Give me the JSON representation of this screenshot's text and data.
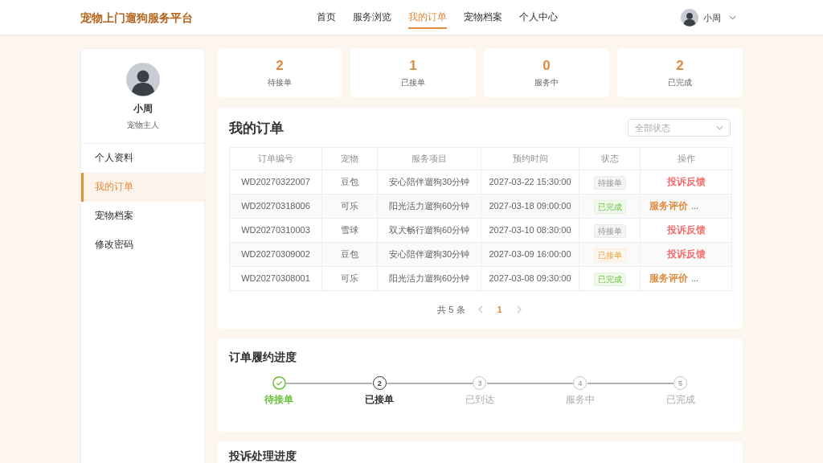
{
  "header": {
    "logo": "宠物上门遛狗服务平台",
    "nav": [
      {
        "label": "首页",
        "selected": false
      },
      {
        "label": "服务浏览",
        "selected": false
      },
      {
        "label": "我的订单",
        "selected": true
      },
      {
        "label": "宠物档案",
        "selected": false
      },
      {
        "label": "个人中心",
        "selected": false
      }
    ],
    "user": {
      "name": "小周"
    }
  },
  "sidebar": {
    "profile": {
      "name": "小周",
      "role": "宠物主人"
    },
    "items": [
      {
        "label": "个人资料",
        "selected": false
      },
      {
        "label": "我的订单",
        "selected": true
      },
      {
        "label": "宠物档案",
        "selected": false
      },
      {
        "label": "修改密码",
        "selected": false
      }
    ]
  },
  "stats": [
    {
      "value": "2",
      "label": "待接单"
    },
    {
      "value": "1",
      "label": "已接单"
    },
    {
      "value": "0",
      "label": "服务中"
    },
    {
      "value": "2",
      "label": "已完成"
    }
  ],
  "orders": {
    "title": "我的订单",
    "filter": {
      "placeholder": "全部状态"
    },
    "table": {
      "columns": [
        "订单编号",
        "宠物",
        "服务项目",
        "预约时间",
        "状态",
        "操作"
      ],
      "rows": [
        {
          "cells": [
            "WD20270322007",
            "豆包",
            "安心陪伴遛狗30分钟",
            "2027-03-22 15:30:00"
          ],
          "status": {
            "label": "待接单",
            "kind": "pending"
          },
          "actions": [
            {
              "label": "投诉反馈",
              "kind": "complaint"
            }
          ]
        },
        {
          "cells": [
            "WD20270318006",
            "可乐",
            "阳光活力遛狗60分钟",
            "2027-03-18 09:00:00"
          ],
          "status": {
            "label": "已完成",
            "kind": "completed"
          },
          "actions": [
            {
              "label": "服务评价",
              "kind": "review"
            },
            {
              "label": "...",
              "kind": "more"
            }
          ]
        },
        {
          "cells": [
            "WD20270310003",
            "雪球",
            "双犬畅行遛狗60分钟",
            "2027-03-10 08:30:00"
          ],
          "status": {
            "label": "待接单",
            "kind": "pending"
          },
          "actions": [
            {
              "label": "投诉反馈",
              "kind": "complaint"
            }
          ]
        },
        {
          "cells": [
            "WD20270309002",
            "豆包",
            "安心陪伴遛狗30分钟",
            "2027-03-09 16:00:00"
          ],
          "status": {
            "label": "已接单",
            "kind": "accepted"
          },
          "actions": [
            {
              "label": "投诉反馈",
              "kind": "complaint"
            }
          ]
        },
        {
          "cells": [
            "WD20270308001",
            "可乐",
            "阳光活力遛狗60分钟",
            "2027-03-08 09:30:00"
          ],
          "status": {
            "label": "已完成",
            "kind": "completed"
          },
          "actions": [
            {
              "label": "服务评价",
              "kind": "review"
            },
            {
              "label": "...",
              "kind": "more"
            }
          ]
        }
      ]
    },
    "pagination": {
      "total": "共 5 条",
      "previous": {
        "disabled": true
      },
      "pages": [
        {
          "label": "1",
          "selected": true
        }
      ],
      "next": {
        "disabled": true
      }
    }
  },
  "fulfillment": {
    "title": "订单履约进度",
    "steps": [
      {
        "kind": "done",
        "label": "待接单"
      },
      {
        "kind": "current",
        "number": "2",
        "label": "已接单"
      },
      {
        "kind": "pending",
        "number": "3",
        "label": "已到达"
      },
      {
        "kind": "pending",
        "number": "4",
        "label": "服务中"
      },
      {
        "kind": "pending",
        "number": "5",
        "label": "已完成"
      }
    ]
  },
  "complaints": {
    "title": "投诉处理进度"
  }
}
